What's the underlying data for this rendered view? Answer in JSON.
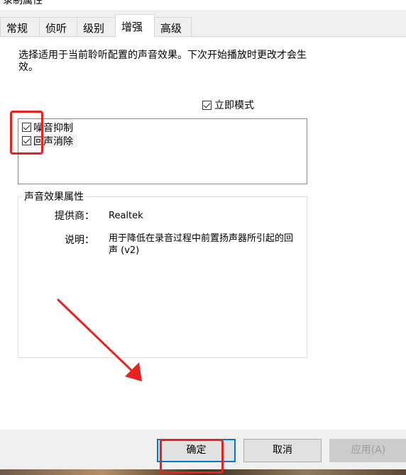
{
  "window": {
    "title": "录制属性"
  },
  "tabs": [
    {
      "label": "常规"
    },
    {
      "label": "侦听"
    },
    {
      "label": "级别"
    },
    {
      "label": "增强"
    },
    {
      "label": "高级"
    }
  ],
  "active_tab": "增强",
  "description": "选择适用于当前聆听配置的声音效果。下次开始播放时更改才会生效。",
  "immediate_mode": {
    "label": "立即模式",
    "checked": true
  },
  "effects": [
    {
      "label": "噪音抑制",
      "checked": true
    },
    {
      "label": "回声消除",
      "checked": true
    }
  ],
  "properties": {
    "title": "声音效果属性",
    "provider_label": "提供商：",
    "provider_value": "Realtek",
    "description_label": "说明：",
    "description_value": "用于降低在录音过程中前置扬声器所引起的回声 (v2)"
  },
  "buttons": {
    "ok": "确定",
    "cancel": "取消",
    "apply": "应用(A)"
  },
  "annotation_color": "#e8231f"
}
